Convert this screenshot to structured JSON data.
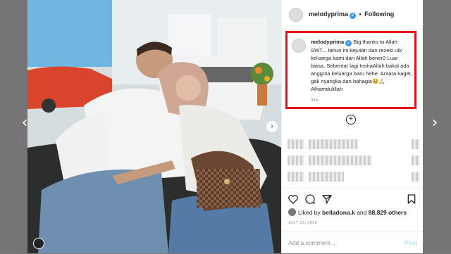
{
  "post": {
    "username": "melodyprima",
    "follow_label": "Following",
    "dot": "•",
    "caption": {
      "username": "melodyprima",
      "text": "Big thanks to Allah SWT... tahun ini kejutan dan rezeki utk keluarga kami dari Allah bener2 Luar biasa. Sebentar lagi InshaAllah bakal ada anggota keluarga baru hehe. Antara kaget, gak nyangka dan bahagia🥺🙏🏻 Alhamdulillah",
      "time": "34w"
    },
    "likes": {
      "prefix": "Liked by",
      "user": "belladona.k",
      "and": "and",
      "count": "88,829 others"
    },
    "date": "JULY 23, 2019",
    "comment_placeholder": "Add a comment...",
    "post_button": "Post"
  },
  "icons": {
    "nav_left": "‹",
    "nav_right": "›",
    "photo_next": "›",
    "plus": "+",
    "verified": "✓"
  },
  "colors": {
    "highlight_border": "#e3141c",
    "verified": "#3897f0",
    "post_button": "#b2dffc"
  }
}
